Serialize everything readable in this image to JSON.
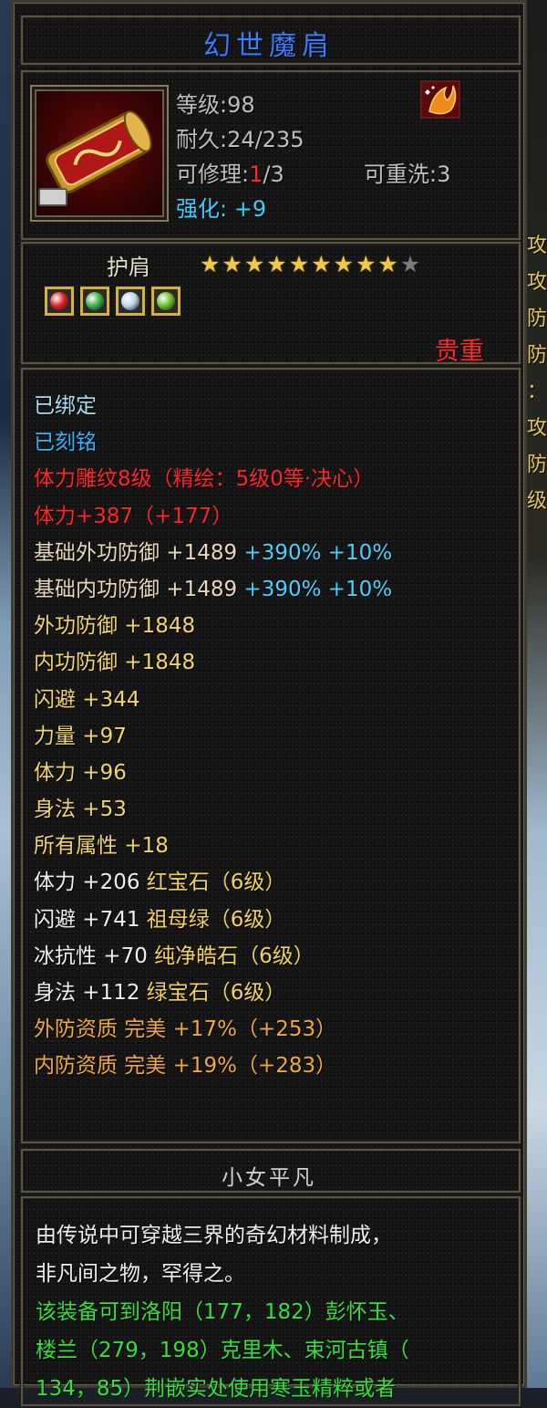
{
  "item": {
    "name": "幻世魔肩",
    "level_label": "等级:98",
    "durability_label": "耐久:24/235",
    "repair_prefix": "可修理:",
    "repair_used": "1",
    "repair_total": "/3",
    "rewash_label": "可重洗:3",
    "enhance_prefix": "强化:",
    "enhance_value": "+9",
    "type": "护肩",
    "rating": 9,
    "rating_max": 10,
    "rarity": "贵重",
    "colors": {
      "title": "#3a7cff",
      "rarity": "#ff2a2a",
      "star_on": "#f2c84a",
      "star_off": "#7a7a7a"
    }
  },
  "gems": [
    {
      "icon": "red-gem-icon",
      "color": "#e0252a"
    },
    {
      "icon": "green-leaf-gem-icon",
      "color": "#3fb34a"
    },
    {
      "icon": "ice-gem-icon",
      "color": "#bcd7ec"
    },
    {
      "icon": "jade-gem-icon",
      "color": "#6cc22f"
    }
  ],
  "attributes": [
    {
      "segments": [
        {
          "text": "已绑定",
          "color": "c-cyan"
        }
      ]
    },
    {
      "segments": [
        {
          "text": "已刻铭",
          "color": "c-blue"
        }
      ]
    },
    {
      "segments": [
        {
          "text": "体力雕纹8级（精绘：5级0等·决心）",
          "color": "c-red"
        }
      ]
    },
    {
      "segments": [
        {
          "text": "体力+387（+177）",
          "color": "c-red"
        }
      ]
    },
    {
      "segments": [
        {
          "text": "基础外功防御 +1489 ",
          "color": "c-tan"
        },
        {
          "text": "+390% +10%",
          "color": "c-sky"
        }
      ]
    },
    {
      "segments": [
        {
          "text": "基础内功防御 +1489 ",
          "color": "c-tan"
        },
        {
          "text": "+390% +10%",
          "color": "c-sky"
        }
      ]
    },
    {
      "segments": [
        {
          "text": "外功防御 +1848",
          "color": "c-yellow"
        }
      ]
    },
    {
      "segments": [
        {
          "text": "内功防御 +1848",
          "color": "c-yellow"
        }
      ]
    },
    {
      "segments": [
        {
          "text": "闪避 +344",
          "color": "c-yellow"
        }
      ]
    },
    {
      "segments": [
        {
          "text": "力量 +97",
          "color": "c-yellow"
        }
      ]
    },
    {
      "segments": [
        {
          "text": "体力 +96",
          "color": "c-yellow"
        }
      ]
    },
    {
      "segments": [
        {
          "text": "身法 +53",
          "color": "c-yellow"
        }
      ]
    },
    {
      "segments": [
        {
          "text": "所有属性 +18",
          "color": "c-yellow"
        }
      ]
    },
    {
      "segments": [
        {
          "text": "体力 +206 ",
          "color": "c-white"
        },
        {
          "text": "红宝石（6级）",
          "color": "c-gold2"
        }
      ]
    },
    {
      "segments": [
        {
          "text": "闪避 +741 ",
          "color": "c-white"
        },
        {
          "text": "祖母绿（6级）",
          "color": "c-gold2"
        }
      ]
    },
    {
      "segments": [
        {
          "text": "冰抗性 +70 ",
          "color": "c-white"
        },
        {
          "text": "纯净皓石（6级）",
          "color": "c-gold2"
        }
      ]
    },
    {
      "segments": [
        {
          "text": "身法 +112 ",
          "color": "c-white"
        },
        {
          "text": "绿宝石（6级）",
          "color": "c-gold2"
        }
      ]
    },
    {
      "segments": [
        {
          "text": "外防资质  完美 +17%（+253）",
          "color": "c-orange"
        }
      ]
    },
    {
      "segments": [
        {
          "text": "内防资质  完美 +19%（+283）",
          "color": "c-orange"
        }
      ]
    }
  ],
  "owner": "小女平凡",
  "description": [
    {
      "text": "由传说中可穿越三界的奇幻材料制成，",
      "color": "c-white"
    },
    {
      "text": "非凡间之物，罕得之。",
      "color": "c-white"
    },
    {
      "text": "该装备可到洛阳（177，182）彭怀玉、",
      "color": "c-green"
    },
    {
      "text": "楼兰（279，198）克里木、束河古镇（",
      "color": "c-green"
    },
    {
      "text": "134，85）荆嵌实处使用寒玉精粹或者",
      "color": "c-green"
    }
  ],
  "background": {
    "right_glyphs": [
      "攻",
      "攻",
      "防",
      "防",
      "：",
      "攻",
      "防",
      "级"
    ]
  }
}
